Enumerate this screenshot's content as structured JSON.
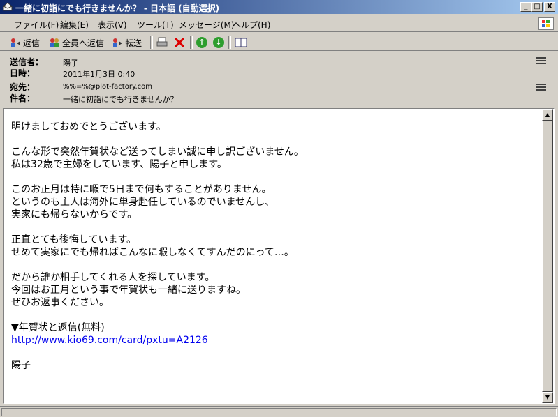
{
  "window": {
    "title": "一緒に初詣にでも行きませんか？ - 日本語 (自動選択)",
    "minimize": "_",
    "maximize": "□",
    "close": "X"
  },
  "menu": [
    "ファイル(F)",
    "編集(E)",
    "表示(V)",
    "ツール(T)",
    "メッセージ(M)",
    "ヘルプ(H)"
  ],
  "toolbar": {
    "reply": "返信",
    "reply_all": "全員へ返信",
    "forward": "転送"
  },
  "header": {
    "from_label": "送信者：",
    "from_value": "陽子",
    "date_label": "日時：",
    "date_value": "2011年1月3日 0:40",
    "to_label": "宛先：",
    "to_value": "%%=%@plot-factory.com",
    "subject_label": "件名：",
    "subject_value": "一緒に初詣にでも行きませんか？"
  },
  "body": {
    "lines": [
      "明けましておめでとうございます。",
      "",
      "こんな形で突然年賀状など送ってしまい誠に申し訳ございません。",
      "私は32歳で主婦をしています、陽子と申します。",
      "",
      "このお正月は特に暇で5日まで何もすることがありません。",
      "というのも主人は海外に単身赴任しているのでいませんし、",
      "実家にも帰らないからです。",
      "",
      "正直とても後悔しています。",
      "せめて実家にでも帰ればこんなに暇しなくてすんだのにって…。",
      "",
      "だから誰か相手してくれる人を探しています。",
      "今回はお正月という事で年賀状も一緒に送りますね。",
      "ぜひお返事ください。",
      "",
      "▼年賀状と返信(無料)"
    ],
    "link": "http://www.kio69.com/card/pxtu=A2126",
    "signature": "陽子"
  }
}
